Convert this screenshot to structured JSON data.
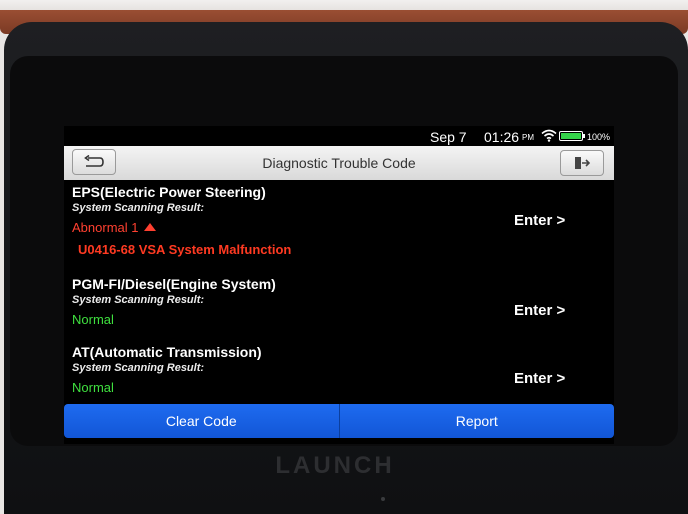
{
  "status": {
    "date": "Sep 7",
    "time": "01:26",
    "ampm": "PM",
    "battery": "100%",
    "battery_color": "#35d44a"
  },
  "header": {
    "title": "Diagnostic Trouble Code",
    "back_icon": "back-arrow-icon",
    "exit_icon": "exit-icon"
  },
  "systems": [
    {
      "name": "EPS(Electric Power Steering)",
      "sub": "System Scanning Result:",
      "result": "Abnormal 1",
      "dtc": "U0416-68 VSA System Malfunction",
      "enter": "Enter >"
    },
    {
      "name": "PGM-FI/Diesel(Engine System)",
      "sub": "System Scanning Result:",
      "result": "Normal",
      "enter": "Enter >"
    },
    {
      "name": "AT(Automatic Transmission)",
      "sub": "System Scanning Result:",
      "result": "Normal",
      "enter": "Enter >"
    }
  ],
  "actions": {
    "clear": "Clear Code",
    "report": "Report"
  },
  "device": {
    "brand": "LAUNCH"
  },
  "colors": {
    "accent": "#1256d6",
    "normal": "#3fe03f",
    "abnormal": "#ff4030"
  }
}
